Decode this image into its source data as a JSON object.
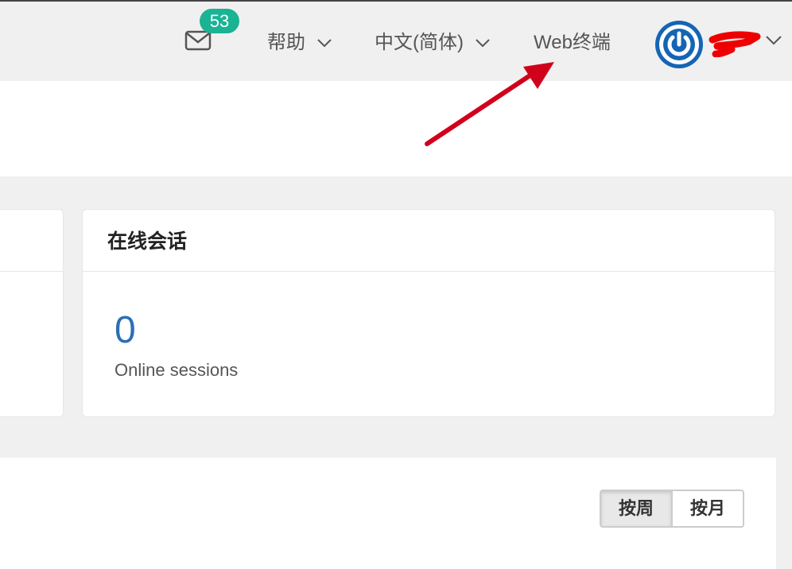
{
  "topbar": {
    "mail": {
      "icon": "envelope-icon",
      "badge_count": "53",
      "badge_color": "#1ab394"
    },
    "help": {
      "label": "帮助",
      "icon": "chevron-down-icon"
    },
    "language": {
      "label": "中文(简体)",
      "icon": "chevron-down-icon"
    },
    "web_terminal": {
      "label": "Web终端"
    },
    "user": {
      "avatar_icon": "power-icon",
      "avatar_color": "#1565b5",
      "icon": "chevron-down-icon"
    }
  },
  "sessions_card": {
    "title": "在线会话",
    "value": "0",
    "caption": "Online sessions",
    "value_color": "#2a6fb7"
  },
  "period_toggle": {
    "options": [
      "按周",
      "按月"
    ],
    "selected": "按周"
  },
  "annotation": {
    "icon": "red-arrow-icon",
    "color": "#d0021b"
  }
}
